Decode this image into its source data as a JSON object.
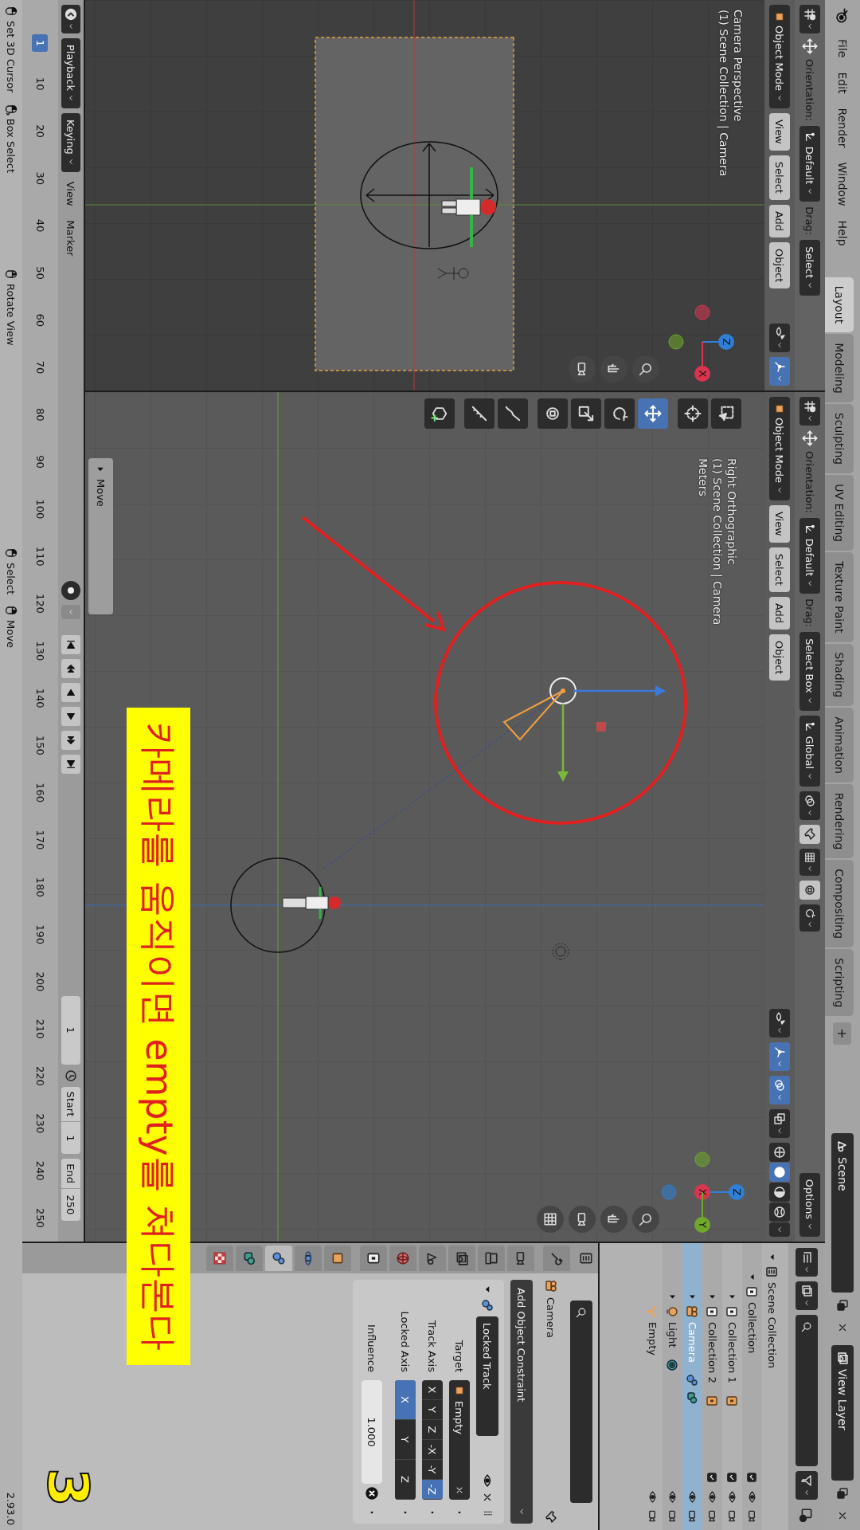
{
  "top_bar": {
    "menus": [
      "File",
      "Edit",
      "Render",
      "Window",
      "Help"
    ],
    "workspaces": [
      {
        "label": "Layout",
        "selected": true
      },
      {
        "label": "Modeling",
        "selected": false
      },
      {
        "label": "Sculpting",
        "selected": false
      },
      {
        "label": "UV Editing",
        "selected": false
      },
      {
        "label": "Texture Paint",
        "selected": false
      },
      {
        "label": "Shading",
        "selected": false
      },
      {
        "label": "Animation",
        "selected": false
      },
      {
        "label": "Rendering",
        "selected": false
      },
      {
        "label": "Compositing",
        "selected": false
      },
      {
        "label": "Scripting",
        "selected": false
      }
    ],
    "add_workspace": "+",
    "scene": "Scene",
    "view_layer": "View Layer"
  },
  "viewports": [
    {
      "kind": "camera",
      "tool_settings": {
        "orientation_label": "Orientation:",
        "orientation": "Default",
        "drag_label": "Drag:",
        "drag": "Select"
      },
      "header": {
        "mode": "Object Mode",
        "menus": [
          "View",
          "Select",
          "Add",
          "Object"
        ],
        "toggles": [
          {
            "kind": "visibility",
            "on": false
          },
          {
            "kind": "gizmo",
            "on": true
          }
        ]
      },
      "overlay_text": [
        "Camera Perspective",
        "(1) Scene Collection | Camera"
      ],
      "gizmo": [
        {
          "label": "Z",
          "color": "#2f7fd6"
        },
        {
          "label": "X",
          "color": "#d9354f"
        }
      ]
    },
    {
      "kind": "ortho",
      "tool_settings": {
        "orientation_label": "Orientation:",
        "orientation": "Default",
        "drag_label": "Drag:",
        "drag": "Select Box",
        "transform": "Global",
        "options": "Options"
      },
      "header": {
        "mode": "Object Mode",
        "menus": [
          "View",
          "Select",
          "Add",
          "Object"
        ],
        "toggles": [
          {
            "kind": "visibility",
            "on": false
          },
          {
            "kind": "gizmo",
            "on": true
          },
          {
            "kind": "overlay",
            "on": true
          },
          {
            "kind": "xray",
            "on": false
          }
        ],
        "shading": [
          {
            "kind": "wireframe",
            "selected": false
          },
          {
            "kind": "solid",
            "selected": true
          },
          {
            "kind": "material",
            "selected": false
          },
          {
            "kind": "rendered",
            "selected": false
          }
        ]
      },
      "overlay_text": [
        "Right Orthographic",
        "(1) Scene Collection | Camera",
        "Meters"
      ],
      "tools": [
        {
          "kind": "select_box",
          "selected": false
        },
        {
          "kind": "cursor",
          "selected": false
        },
        {
          "kind": "move",
          "selected": true
        },
        {
          "kind": "rotate",
          "selected": false
        },
        {
          "kind": "scale",
          "selected": false
        },
        {
          "kind": "transform",
          "selected": false
        },
        {
          "kind": "annotate",
          "selected": false
        },
        {
          "kind": "measure",
          "selected": false
        },
        {
          "kind": "add_cube",
          "selected": false
        }
      ],
      "gizmo": [
        {
          "label": "Z",
          "color": "#2f7fd6"
        },
        {
          "label": "X",
          "color": "#d9354f"
        },
        {
          "label": "Y",
          "color": "#6fa82a"
        }
      ],
      "operator_panel": "Move"
    }
  ],
  "outliner": {
    "tree": [
      {
        "label": "Scene Collection",
        "kind": "scene_collection",
        "expanded": true,
        "selected": false,
        "children": [
          {
            "label": "Collection",
            "kind": "collection",
            "expanded": true,
            "selected": false,
            "included": true,
            "children": [
              {
                "label": "Collection 1",
                "kind": "collection",
                "expanded": false,
                "selected": false,
                "included": true
              },
              {
                "label": "Collection 2",
                "kind": "collection",
                "expanded": false,
                "selected": false,
                "included": true
              },
              {
                "label": "Camera",
                "kind": "camera",
                "expanded": false,
                "selected": true
              },
              {
                "label": "Light",
                "kind": "light",
                "expanded": false,
                "selected": false
              },
              {
                "label": "Empty",
                "kind": "empty",
                "selected": false
              }
            ]
          }
        ]
      }
    ]
  },
  "properties": {
    "tabs": [
      {
        "kind": "tool",
        "selected": false
      },
      {
        "kind": "render",
        "selected": false
      },
      {
        "kind": "output",
        "selected": false
      },
      {
        "kind": "view_layer",
        "selected": false
      },
      {
        "kind": "scene",
        "selected": false
      },
      {
        "kind": "world",
        "selected": false
      },
      {
        "kind": "collection",
        "selected": false
      },
      {
        "kind": "object",
        "selected": false
      },
      {
        "kind": "physics",
        "selected": false
      },
      {
        "kind": "constraints",
        "selected": true
      },
      {
        "kind": "data",
        "selected": false
      },
      {
        "kind": "texture",
        "selected": false
      }
    ],
    "object_name": "Camera",
    "add_constraint": "Add Object Constraint",
    "constraint": {
      "name": "Locked Track",
      "expanded": true,
      "target_label": "Target",
      "target": "Empty",
      "track_axis_label": "Track Axis",
      "track_axis": [
        {
          "label": "X",
          "selected": false
        },
        {
          "label": "Y",
          "selected": false
        },
        {
          "label": "Z",
          "selected": false
        },
        {
          "label": "-X",
          "selected": false
        },
        {
          "label": "-Y",
          "selected": false
        },
        {
          "label": "-Z",
          "selected": true
        }
      ],
      "locked_axis_label": "Locked Axis",
      "locked_axis": [
        {
          "label": "X",
          "selected": true
        },
        {
          "label": "Y",
          "selected": false
        },
        {
          "label": "Z",
          "selected": false
        }
      ],
      "influence_label": "Influence",
      "influence": "1.000",
      "level": 1
    }
  },
  "timeline": {
    "menus": [
      "Playback",
      "Keying",
      "View",
      "Marker"
    ],
    "auto_keying": false,
    "current_frame": "1",
    "start_label": "Start",
    "start": "1",
    "end_label": "End",
    "end": "250",
    "playhead": "1",
    "ruler": [
      "10",
      "20",
      "30",
      "40",
      "50",
      "60",
      "70",
      "80",
      "90",
      "100",
      "110",
      "120",
      "130",
      "140",
      "150",
      "160",
      "170",
      "180",
      "190",
      "200",
      "210",
      "220",
      "230",
      "240",
      "250"
    ]
  },
  "status_bar": {
    "groups": [
      [
        {
          "kind": "mouse_left",
          "label": "Set 3D Cursor"
        },
        {
          "kind": "mouse_drag",
          "label": "Box Select"
        }
      ],
      [
        {
          "kind": "mouse_middle",
          "label": "Rotate View"
        }
      ],
      [
        {
          "kind": "mouse_left",
          "label": "Select"
        },
        {
          "kind": "mouse_right",
          "label": "Move"
        }
      ]
    ],
    "version": "2.93.0"
  },
  "annotation": {
    "caption": "카메라를 움직이면 empty를 쳐다본다",
    "step": "3"
  }
}
